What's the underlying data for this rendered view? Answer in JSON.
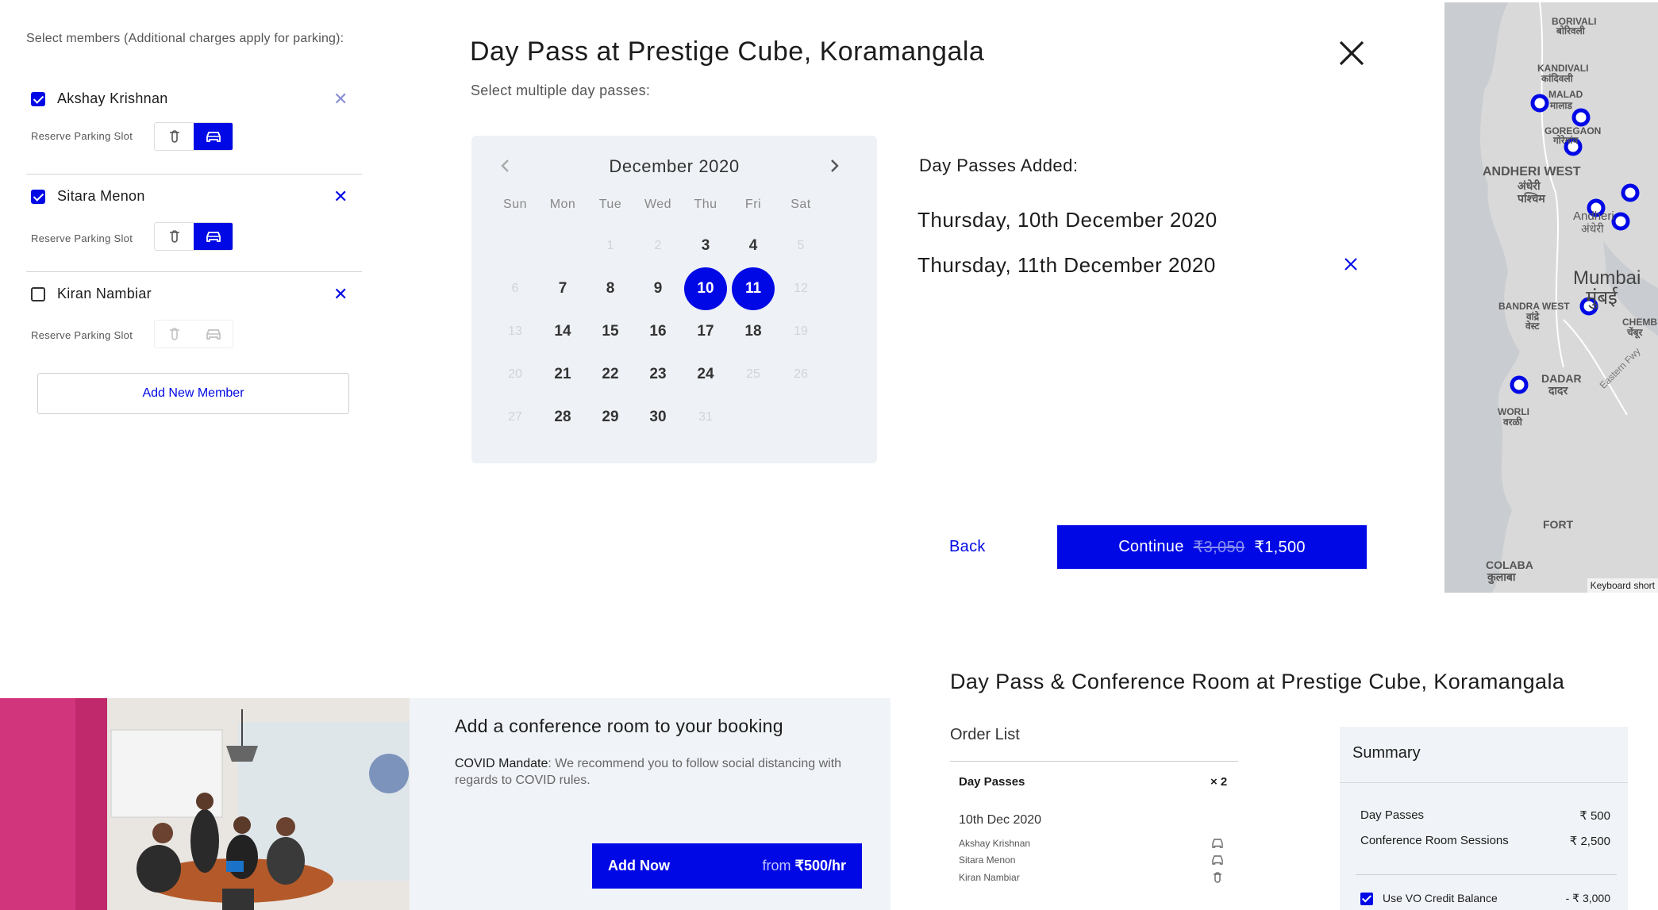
{
  "members_panel": {
    "heading": "Select members (Additional charges apply for parking):",
    "parking_label": "Reserve Parking Slot",
    "members": [
      {
        "name": "Akshay Krishnan",
        "checked": true,
        "parking": "car"
      },
      {
        "name": "Sitara Menon",
        "checked": true,
        "parking": "car"
      },
      {
        "name": "Kiran Nambiar",
        "checked": false,
        "parking": "none"
      }
    ],
    "add_member_label": "Add New Member"
  },
  "day_pass_modal": {
    "title": "Day Pass at Prestige Cube, Koramangala",
    "subtitle": "Select multiple day passes:",
    "calendar": {
      "month": "December 2020",
      "weekdays": [
        "Sun",
        "Mon",
        "Tue",
        "Wed",
        "Thu",
        "Fri",
        "Sat"
      ],
      "days": [
        {
          "d": "",
          "s": "empty"
        },
        {
          "d": "",
          "s": "empty"
        },
        {
          "d": "1",
          "s": "muted"
        },
        {
          "d": "2",
          "s": "muted"
        },
        {
          "d": "3",
          "s": "active"
        },
        {
          "d": "4",
          "s": "active"
        },
        {
          "d": "5",
          "s": "muted"
        },
        {
          "d": "6",
          "s": "muted"
        },
        {
          "d": "7",
          "s": "active"
        },
        {
          "d": "8",
          "s": "active"
        },
        {
          "d": "9",
          "s": "active"
        },
        {
          "d": "10",
          "s": "selected"
        },
        {
          "d": "11",
          "s": "selected"
        },
        {
          "d": "12",
          "s": "muted"
        },
        {
          "d": "13",
          "s": "muted"
        },
        {
          "d": "14",
          "s": "active"
        },
        {
          "d": "15",
          "s": "active"
        },
        {
          "d": "16",
          "s": "active"
        },
        {
          "d": "17",
          "s": "active"
        },
        {
          "d": "18",
          "s": "active"
        },
        {
          "d": "19",
          "s": "muted"
        },
        {
          "d": "20",
          "s": "muted"
        },
        {
          "d": "21",
          "s": "active"
        },
        {
          "d": "22",
          "s": "active"
        },
        {
          "d": "23",
          "s": "active"
        },
        {
          "d": "24",
          "s": "active"
        },
        {
          "d": "25",
          "s": "muted"
        },
        {
          "d": "26",
          "s": "muted"
        },
        {
          "d": "27",
          "s": "muted"
        },
        {
          "d": "28",
          "s": "active"
        },
        {
          "d": "29",
          "s": "active"
        },
        {
          "d": "30",
          "s": "active"
        },
        {
          "d": "31",
          "s": "muted"
        }
      ]
    },
    "added_heading": "Day Passes Added:",
    "added_items": [
      "Thursday, 10th December 2020",
      "Thursday, 11th December 2020"
    ],
    "back_label": "Back",
    "continue_label": "Continue",
    "continue_old_price": "₹3,050",
    "continue_price": "₹1,500"
  },
  "map": {
    "labels": [
      "BORIVALI",
      "बोरिवली",
      "KANDIVALI",
      "कांदिवली",
      "MALAD",
      "मालाड",
      "GOREGAON",
      "गोरेगांव",
      "ANDHERI WEST",
      "अंधेरी",
      "पश्चिम",
      "Andheri",
      "अंधेरी",
      "Mumbai",
      "मुंबई",
      "BANDRA WEST",
      "वांद्रे",
      "वेस्ट",
      "CHEMB",
      "चेंबूर",
      "DADAR",
      "दादर",
      "Eastern Fwy",
      "WORLI",
      "वरळी",
      "FORT",
      "COLABA",
      "कुलाबा"
    ],
    "footer": "Keyboard short"
  },
  "conference": {
    "title": "Add a conference room to your booking",
    "mandate_label": "COVID Mandate",
    "mandate_text": ": We recommend you to follow social distancing with regards to COVID rules.",
    "add_now_label": "Add Now",
    "price_prefix": "from",
    "price": "₹500/hr"
  },
  "order": {
    "title": "Day Pass & Conference Room at Prestige Cube, Koramangala",
    "list_label": "Order List",
    "day_passes_label": "Day Passes",
    "day_passes_count": "× 2",
    "date": "10th Dec 2020",
    "members": [
      {
        "name": "Akshay Krishnan",
        "icon": "car-icon"
      },
      {
        "name": "Sitara Menon",
        "icon": "car-icon"
      },
      {
        "name": "Kiran Nambiar",
        "icon": "bike-icon"
      }
    ]
  },
  "summary": {
    "title": "Summary",
    "rows": [
      {
        "label": "Day Passes",
        "value": "₹ 500"
      },
      {
        "label": "Conference Room Sessions",
        "value": "₹ 2,500"
      }
    ],
    "credit_label": "Use VO Credit Balance",
    "credit_value": "- ₹ 3,000"
  },
  "colors": {
    "accent": "#0009e5",
    "panel_bg": "#eef1f5",
    "map_bg": "#d9d9d9"
  }
}
